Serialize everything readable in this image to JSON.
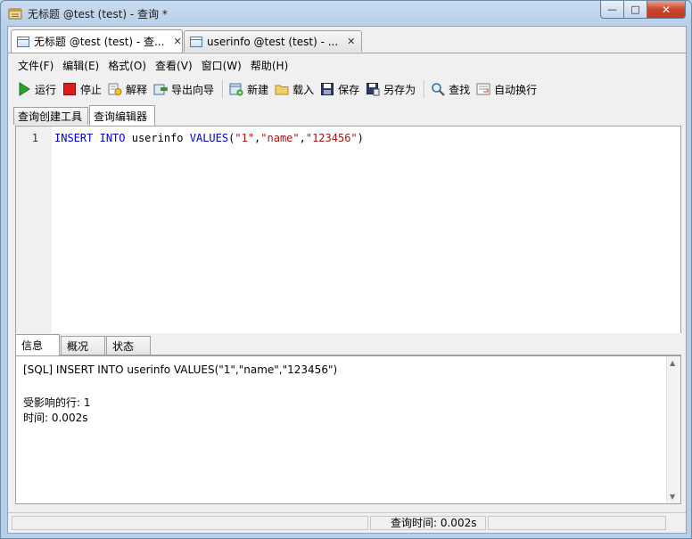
{
  "window": {
    "title": "无标题 @test (test) - 查询 *",
    "minimize": "—",
    "maximize": "□",
    "close": "✕"
  },
  "doc_tabs": [
    {
      "label": "无标题 @test (test) - 查...",
      "close": "✕"
    },
    {
      "label": "userinfo @test (test) - ...",
      "close": "✕"
    }
  ],
  "menu": [
    "文件(F)",
    "编辑(E)",
    "格式(O)",
    "查看(V)",
    "窗口(W)",
    "帮助(H)"
  ],
  "toolbar": {
    "run": "运行",
    "stop": "停止",
    "explain": "解释",
    "export_wizard": "导出向导",
    "new": "新建",
    "load": "载入",
    "save": "保存",
    "save_as": "另存为",
    "find": "查找",
    "word_wrap": "自动换行"
  },
  "sub_tabs": [
    "查询创建工具",
    "查询编辑器"
  ],
  "editor": {
    "line_number": "1",
    "tokens": [
      {
        "t": "INSERT",
        "c": "kw"
      },
      {
        "t": " ",
        "c": "plain"
      },
      {
        "t": "INTO",
        "c": "kw"
      },
      {
        "t": " userinfo ",
        "c": "plain"
      },
      {
        "t": "VALUES",
        "c": "kw"
      },
      {
        "t": "(",
        "c": "plain"
      },
      {
        "t": "\"1\"",
        "c": "str"
      },
      {
        "t": ",",
        "c": "plain"
      },
      {
        "t": "\"name\"",
        "c": "str"
      },
      {
        "t": ",",
        "c": "plain"
      },
      {
        "t": "\"123456\"",
        "c": "str"
      },
      {
        "t": ")",
        "c": "plain"
      }
    ]
  },
  "result_tabs": [
    "信息",
    "概况",
    "状态"
  ],
  "results": {
    "sql_line": "[SQL] INSERT INTO userinfo VALUES(\"1\",\"name\",\"123456\")",
    "affected_rows": "受影响的行: 1",
    "time": "时间: 0.002s"
  },
  "status": {
    "query_time": "查询时间: 0.002s"
  },
  "colors": {
    "keyword": "#0000c8",
    "string": "#a31515"
  }
}
